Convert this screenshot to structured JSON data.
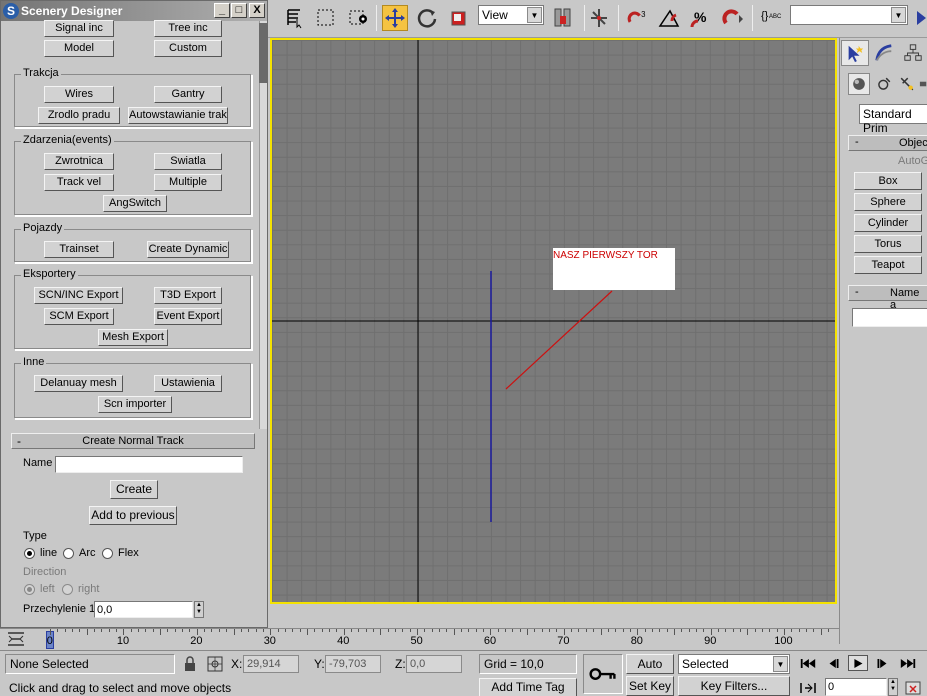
{
  "window": {
    "title": "Scenery Designer",
    "icon_letter": "S",
    "min_label": "_",
    "max_label": "□",
    "close_label": "X"
  },
  "top_buttons": [
    "Signal inc",
    "Tree inc",
    "Model",
    "Custom"
  ],
  "groups": {
    "trakcja": {
      "legend": "Trakcja",
      "buttons": [
        "Wires",
        "Gantry",
        "Zrodlo pradu",
        "Autowstawianie trakc"
      ]
    },
    "zdarzenia": {
      "legend": "Zdarzenia(events)",
      "buttons": [
        "Zwrotnica",
        "Swiatla",
        "Track vel",
        "Multiple",
        "AngSwitch"
      ]
    },
    "pojazdy": {
      "legend": "Pojazdy",
      "buttons": [
        "Trainset",
        "Create Dynamic"
      ]
    },
    "eksportery": {
      "legend": "Eksportery",
      "buttons": [
        "SCN/INC Export",
        "T3D Export",
        "SCM Export",
        "Event Export",
        "Mesh Export"
      ]
    },
    "inne": {
      "legend": "Inne",
      "buttons": [
        "Delanuay mesh",
        "Ustawienia",
        "Scn importer"
      ]
    }
  },
  "rollout": {
    "collapse_label": "-",
    "title": "Create Normal Track",
    "name_label": "Name",
    "name_value": "",
    "create_label": "Create",
    "add_prev_label": "Add to previous",
    "type_label": "Type",
    "type_options": [
      "line",
      "Arc",
      "Flex"
    ],
    "type_selected": "line",
    "direction_label": "Direction",
    "direction_options": [
      "left",
      "right"
    ],
    "direction_selected": "left",
    "tilt_label": "Przechylenie 1",
    "tilt_value": "0,0"
  },
  "toolbar": {
    "view_combo": "View",
    "selection_set": "",
    "snap_3": "3",
    "percent": "%"
  },
  "viewport": {
    "label": "NASZ PIERWSZY TOR",
    "colors": {
      "border": "#f4e200",
      "track_blue": "#1a1a9c",
      "track_red": "#cc1111"
    }
  },
  "command_panel": {
    "category": "Standard Prim",
    "section1": "Objec",
    "autogrid": "AutoG",
    "objects": [
      "Box",
      "Sphere",
      "Cylinder",
      "Torus",
      "Teapot"
    ],
    "section2": "Name a",
    "section_collapse": "-"
  },
  "timeline": {
    "ticks": [
      0,
      10,
      20,
      30,
      40,
      50,
      60,
      70,
      80,
      90,
      100
    ]
  },
  "status": {
    "selection": "None Selected",
    "x_label": "X:",
    "x_value": "29,914",
    "y_label": "Y:",
    "y_value": "-79,703",
    "z_label": "Z:",
    "z_value": "0,0",
    "grid": "Grid = 10,0",
    "auto_key": "Auto Key",
    "selected_combo": "Selected",
    "set_key": "Set Key",
    "key_filters": "Key Filters...",
    "prompt": "Click and drag to select and move objects",
    "time_tag": "Add Time Tag",
    "frame_value": "0"
  }
}
